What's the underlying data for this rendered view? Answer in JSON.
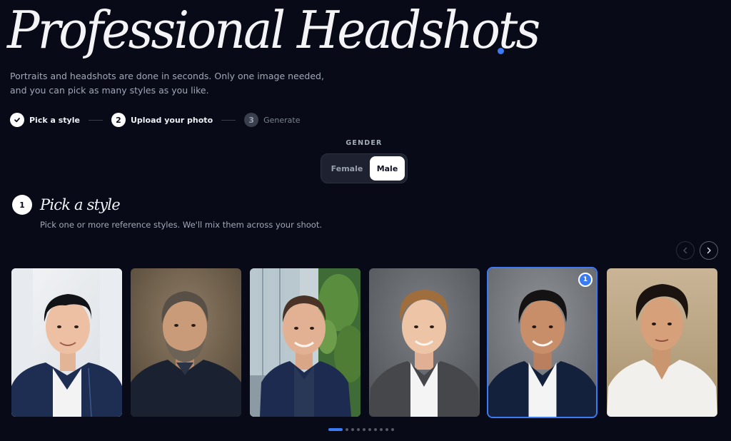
{
  "hero": {
    "title": "Professional Headshots",
    "subtitle_line1": "Portraits and headshots are done in seconds. Only one image needed,",
    "subtitle_line2": "and you can pick as many styles as you like."
  },
  "stepper": {
    "steps": [
      {
        "label": "Pick a style",
        "marker": "check-icon",
        "state": "done"
      },
      {
        "label": "Upload your photo",
        "marker": "2",
        "state": "active"
      },
      {
        "label": "Generate",
        "marker": "3",
        "state": "pending"
      }
    ]
  },
  "gender": {
    "label": "GENDER",
    "options": [
      "Female",
      "Male"
    ],
    "selected": "Male"
  },
  "section": {
    "number": "1",
    "title": "Pick a style",
    "subtitle": "Pick one or more reference styles. We'll mix them across your shoot."
  },
  "carousel": {
    "prev_icon": "chevron-left-icon",
    "next_icon": "chevron-right-icon",
    "cards": [
      {
        "name": "style-card-bright-office",
        "selected": false,
        "badge": ""
      },
      {
        "name": "style-card-warm-studio",
        "selected": false,
        "badge": ""
      },
      {
        "name": "style-card-modern-office",
        "selected": false,
        "badge": ""
      },
      {
        "name": "style-card-grey-studio",
        "selected": false,
        "badge": ""
      },
      {
        "name": "style-card-navy-suit",
        "selected": true,
        "badge": "1"
      },
      {
        "name": "style-card-beige-casual",
        "selected": false,
        "badge": ""
      }
    ],
    "page_count": 10,
    "current_page": 1
  },
  "colors": {
    "background": "#080b17",
    "accent": "#3b7bf5",
    "text_muted": "#a2a7b7"
  }
}
